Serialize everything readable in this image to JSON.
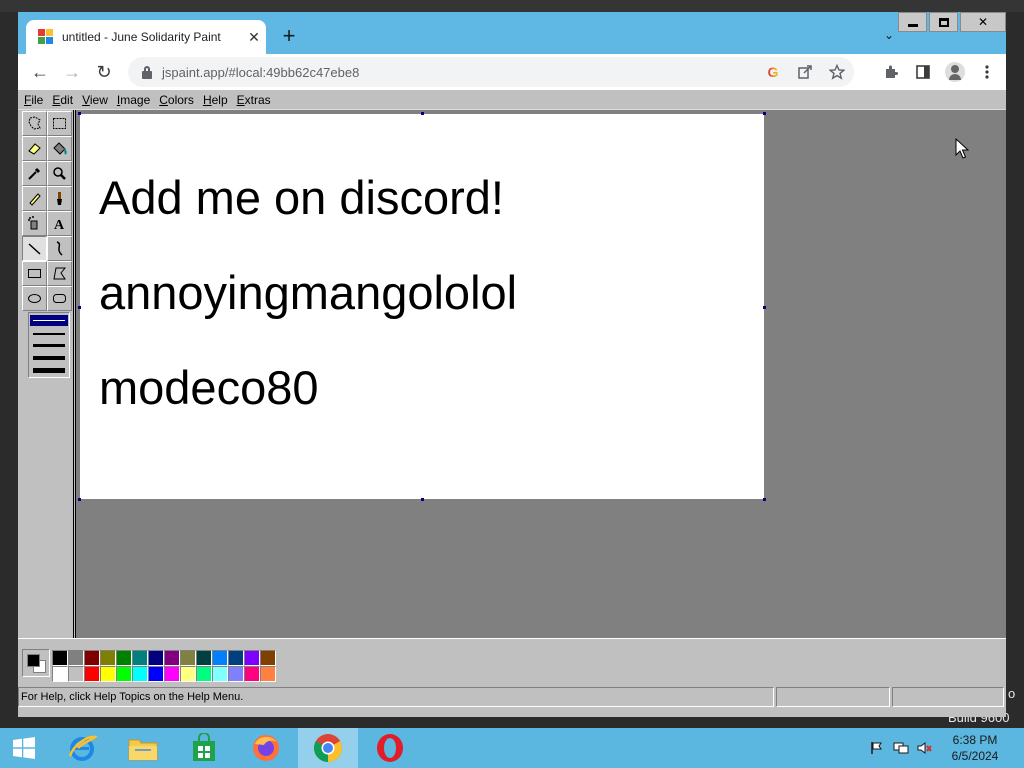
{
  "desktop": {
    "build_text": "Build 9600",
    "build_text_top": "o"
  },
  "browser": {
    "tab": {
      "title": "untitled - June Solidarity Paint",
      "close_glyph": "✕"
    },
    "new_tab_glyph": "+",
    "tab_list_glyph": "⌄",
    "caption": {
      "close_glyph": "✕"
    },
    "nav": {
      "back_glyph": "←",
      "forward_glyph": "→",
      "reload_glyph": "↻"
    },
    "address": {
      "url": "jspaint.app/#local:49bb62c47ebe8"
    },
    "omnibox_icons": [
      "google-icon",
      "share-icon",
      "bookmark-star-icon"
    ],
    "toolbar_icons": [
      "extensions-icon",
      "side-panel-icon",
      "profile-icon",
      "menu-icon"
    ]
  },
  "paint": {
    "menu": [
      "File",
      "Edit",
      "View",
      "Image",
      "Colors",
      "Help",
      "Extras"
    ],
    "tools": [
      {
        "name": "free-form-select",
        "icon": "freeform-select-icon",
        "selected": false
      },
      {
        "name": "select",
        "icon": "rect-select-icon",
        "selected": false
      },
      {
        "name": "eraser",
        "icon": "eraser-icon",
        "selected": false
      },
      {
        "name": "fill",
        "icon": "fill-bucket-icon",
        "selected": false
      },
      {
        "name": "pick-color",
        "icon": "eyedropper-icon",
        "selected": false
      },
      {
        "name": "magnifier",
        "icon": "magnifier-icon",
        "selected": false
      },
      {
        "name": "pencil",
        "icon": "pencil-icon",
        "selected": false
      },
      {
        "name": "brush",
        "icon": "brush-icon",
        "selected": false
      },
      {
        "name": "airbrush",
        "icon": "airbrush-icon",
        "selected": false
      },
      {
        "name": "text",
        "icon": "text-icon",
        "selected": false,
        "glyph": "A"
      },
      {
        "name": "line",
        "icon": "line-icon",
        "selected": true
      },
      {
        "name": "curve",
        "icon": "curve-icon",
        "selected": false
      },
      {
        "name": "rectangle",
        "icon": "rectangle-icon",
        "selected": false
      },
      {
        "name": "polygon",
        "icon": "polygon-icon",
        "selected": false
      },
      {
        "name": "ellipse",
        "icon": "ellipse-icon",
        "selected": false
      },
      {
        "name": "rounded-rectangle",
        "icon": "rounded-rect-icon",
        "selected": false
      }
    ],
    "line_widths": [
      1,
      2,
      3,
      4,
      5
    ],
    "selected_line_width": 1,
    "canvas_text": [
      "Add me on discord!",
      "annoyingmangololol",
      "modeco80"
    ],
    "colors": {
      "foreground": "#000000",
      "background": "#ffffff"
    },
    "palette": [
      "#000000",
      "#808080",
      "#800000",
      "#808000",
      "#008000",
      "#008080",
      "#000080",
      "#800080",
      "#808040",
      "#004040",
      "#0080ff",
      "#004080",
      "#8000ff",
      "#804000",
      "#ffffff",
      "#c0c0c0",
      "#ff0000",
      "#ffff00",
      "#00ff00",
      "#00ffff",
      "#0000ff",
      "#ff00ff",
      "#ffff80",
      "#00ff80",
      "#80ffff",
      "#8080ff",
      "#ff0080",
      "#ff8040"
    ],
    "status": {
      "help_text": "For Help, click Help Topics on the Help Menu.",
      "position": "",
      "size": ""
    }
  },
  "taskbar": {
    "apps": [
      {
        "name": "internet-explorer",
        "icon": "ie-icon",
        "active": false
      },
      {
        "name": "file-explorer",
        "icon": "folder-icon",
        "active": false
      },
      {
        "name": "store",
        "icon": "store-icon",
        "active": false
      },
      {
        "name": "firefox",
        "icon": "firefox-icon",
        "active": false
      },
      {
        "name": "chrome",
        "icon": "chrome-icon",
        "active": true
      },
      {
        "name": "opera",
        "icon": "opera-icon",
        "active": false
      }
    ],
    "clock": {
      "time": "6:38 PM",
      "date": "6/5/2024"
    }
  }
}
